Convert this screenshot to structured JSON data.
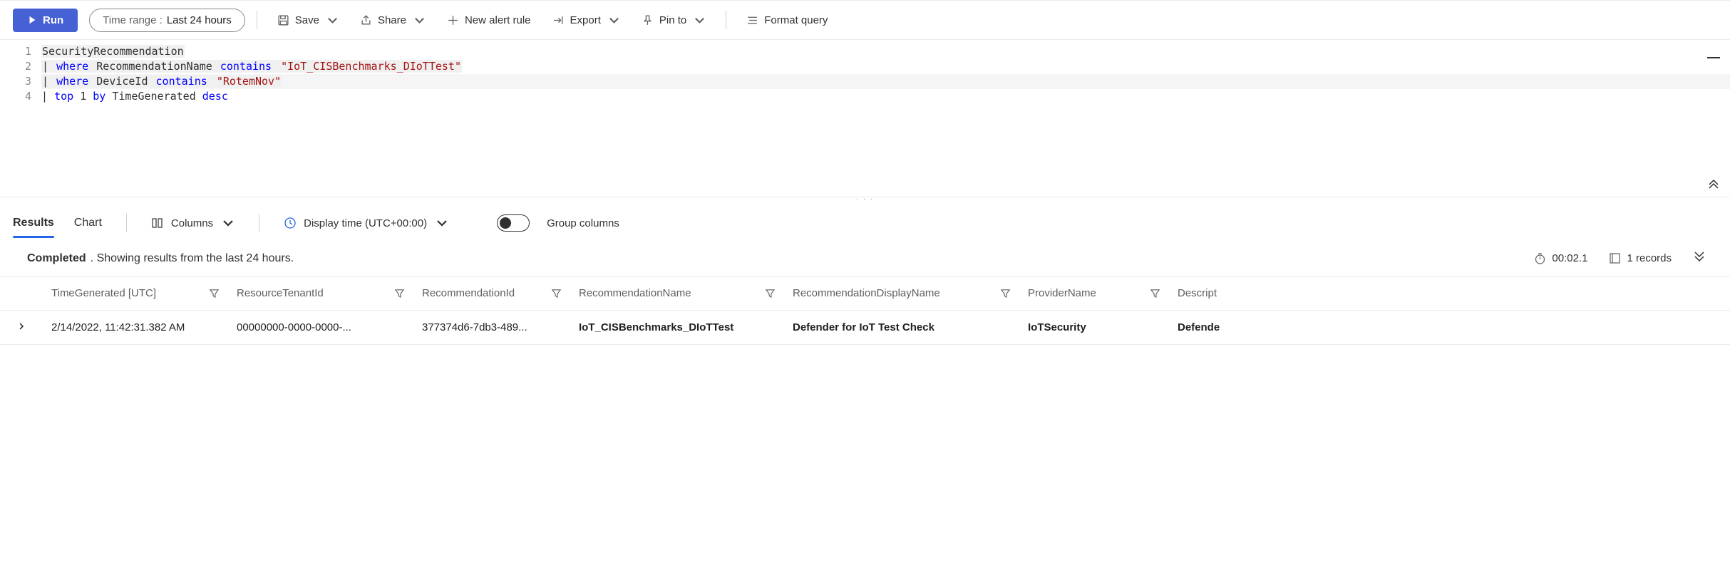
{
  "toolbar": {
    "run_label": "Run",
    "time_range_label": "Time range :",
    "time_range_value": "Last 24 hours",
    "save_label": "Save",
    "share_label": "Share",
    "new_alert_label": "New alert rule",
    "export_label": "Export",
    "pin_to_label": "Pin to",
    "format_query_label": "Format query"
  },
  "editor": {
    "lines": [
      {
        "n": 1,
        "tokens": [
          {
            "t": "SecurityRecommendation",
            "cls": "hl-bg"
          }
        ]
      },
      {
        "n": 2,
        "tokens": [
          {
            "t": "| ",
            "cls": "hl-bg tok-pipe"
          },
          {
            "t": "where",
            "cls": "hl-bg tok-kw"
          },
          {
            "t": " RecommendationName ",
            "cls": "hl-bg"
          },
          {
            "t": "contains",
            "cls": "hl-bg tok-kw"
          },
          {
            "t": " ",
            "cls": "hl-bg"
          },
          {
            "t": "\"IoT_CISBenchmarks_DIoTTest\"",
            "cls": "hl-bg tok-str"
          }
        ]
      },
      {
        "n": 3,
        "active": true,
        "tokens": [
          {
            "t": "| ",
            "cls": "hl-bg tok-pipe"
          },
          {
            "t": "where",
            "cls": "hl-bg tok-kw"
          },
          {
            "t": " DeviceId ",
            "cls": "hl-bg"
          },
          {
            "t": "contains",
            "cls": "hl-bg tok-kw"
          },
          {
            "t": " ",
            "cls": "hl-bg"
          },
          {
            "t": "\"RotemNov\"",
            "cls": "hl-bg tok-str"
          }
        ]
      },
      {
        "n": 4,
        "tokens": [
          {
            "t": "| ",
            "cls": "tok-pipe"
          },
          {
            "t": "top",
            "cls": "tok-kw"
          },
          {
            "t": " ",
            "cls": ""
          },
          {
            "t": "1",
            "cls": "tok-num"
          },
          {
            "t": " ",
            "cls": ""
          },
          {
            "t": "by",
            "cls": "tok-kw"
          },
          {
            "t": " TimeGenerated ",
            "cls": ""
          },
          {
            "t": "desc",
            "cls": "tok-kw"
          }
        ]
      }
    ]
  },
  "result_toolbar": {
    "tab_results": "Results",
    "tab_chart": "Chart",
    "columns_label": "Columns",
    "display_time_label": "Display time (UTC+00:00)",
    "group_columns_label": "Group columns"
  },
  "status": {
    "completed": "Completed",
    "showing": ". Showing results from the last 24 hours.",
    "duration": "00:02.1",
    "records": "1 records"
  },
  "columns": {
    "time": "TimeGenerated [UTC]",
    "tenant": "ResourceTenantId",
    "recid": "RecommendationId",
    "recname": "RecommendationName",
    "recdisp": "RecommendationDisplayName",
    "provider": "ProviderName",
    "desc": "Descript"
  },
  "rows": [
    {
      "time": "2/14/2022, 11:42:31.382 AM",
      "tenant": "00000000-0000-0000-...",
      "recid": "377374d6-7db3-489...",
      "recname": "IoT_CISBenchmarks_DIoTTest",
      "recdisp": "Defender for IoT Test Check",
      "provider": "IoTSecurity",
      "desc": "Defende"
    }
  ]
}
